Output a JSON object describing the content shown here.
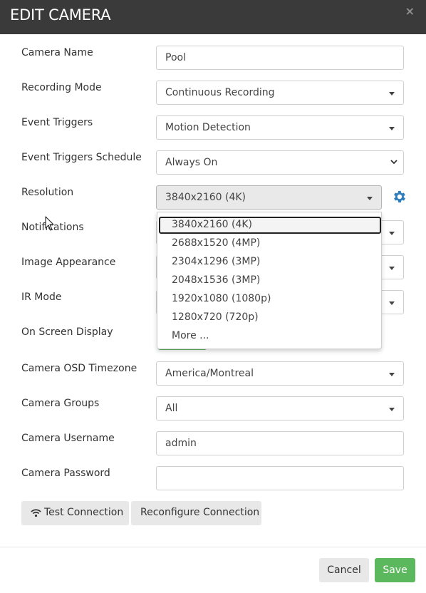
{
  "header": {
    "title": "EDIT CAMERA",
    "close_glyph": "×"
  },
  "form": {
    "camera_name": {
      "label": "Camera Name",
      "value": "Pool"
    },
    "recording_mode": {
      "label": "Recording Mode",
      "value": "Continuous Recording"
    },
    "event_triggers": {
      "label": "Event Triggers",
      "value": "Motion Detection"
    },
    "event_triggers_schedule": {
      "label": "Event Triggers Schedule",
      "value": "Always On"
    },
    "resolution": {
      "label": "Resolution",
      "value": "3840x2160 (4K)"
    },
    "notifications": {
      "label": "Notifications"
    },
    "image_appearance": {
      "label": "Image Appearance"
    },
    "ir_mode": {
      "label": "IR Mode"
    },
    "on_screen_display": {
      "label": "On Screen Display"
    },
    "osd_timezone": {
      "label": "Camera OSD Timezone",
      "value": "America/Montreal"
    },
    "camera_groups": {
      "label": "Camera Groups",
      "value": "All"
    },
    "camera_username": {
      "label": "Camera Username",
      "value": "admin"
    },
    "camera_password": {
      "label": "Camera Password",
      "value": ""
    }
  },
  "resolution_dropdown": {
    "options": [
      "3840x2160 (4K)",
      "2688x1520 (4MP)",
      "2304x1296 (3MP)",
      "2048x1536 (3MP)",
      "1920x1080 (1080p)",
      "1280x720 (720p)",
      "More ..."
    ],
    "selected": "3840x2160 (4K)"
  },
  "actions": {
    "test_connection": "Test Connection",
    "reconfigure_connection": "Reconfigure Connection"
  },
  "footer": {
    "cancel": "Cancel",
    "save": "Save"
  },
  "icons": {
    "close": "close-icon",
    "gear": "gear-icon",
    "wifi": "wifi-icon",
    "caret": "caret-down-icon",
    "chevron": "chevron-down-icon",
    "cursor": "mouse-pointer-icon"
  },
  "colors": {
    "header_bg": "#3a3a3a",
    "save_green": "#5cb85c",
    "gear_blue": "#2f7fbf",
    "button_gray": "#e8e8e8"
  }
}
